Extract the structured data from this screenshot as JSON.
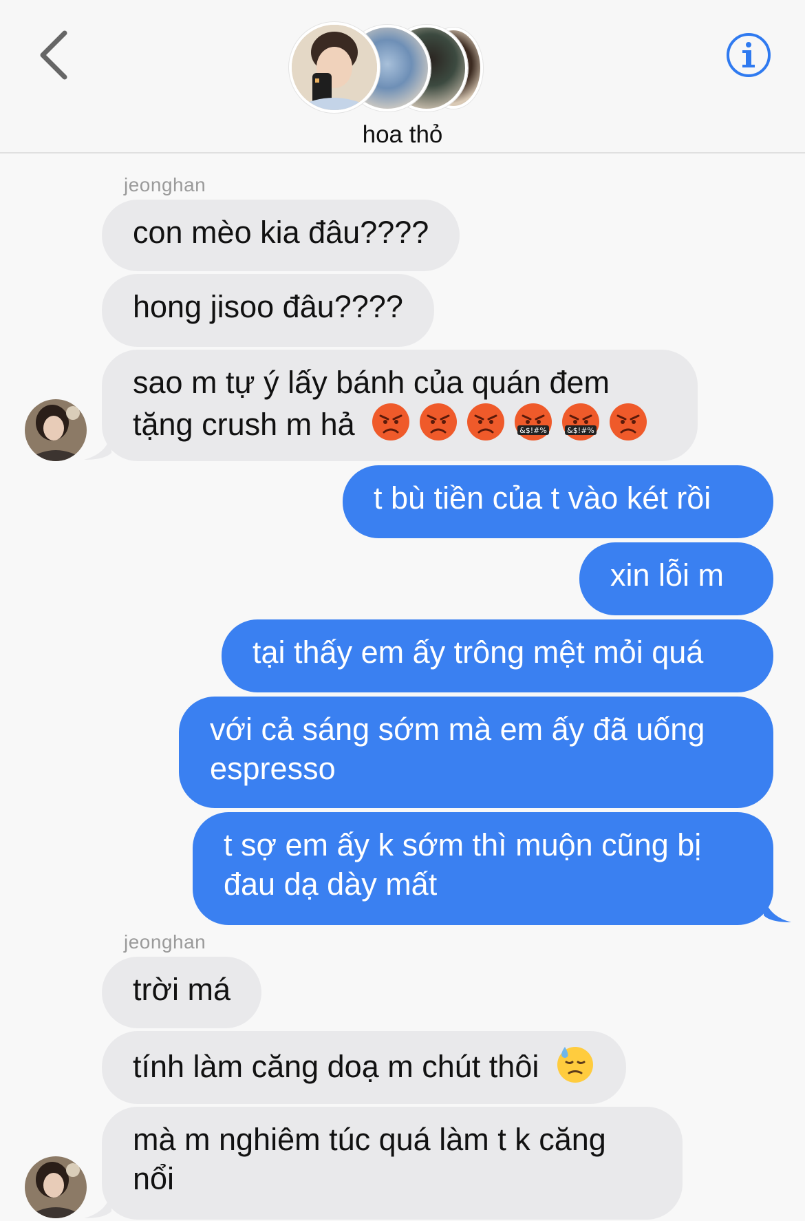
{
  "header": {
    "group_name": "hoa thỏ",
    "back_icon": "chevron-left-icon",
    "info_icon": "info-circle-icon"
  },
  "colors": {
    "outgoing_bubble": "#3a80f1",
    "incoming_bubble": "#e9e9eb",
    "accent": "#2f7af0",
    "background": "#f8f8f8"
  },
  "messages": {
    "sender_1": "jeonghan",
    "m1": "con mèo kia đâu????",
    "m2": "hong jisoo đâu????",
    "m3_line1": "sao m tự ý lấy bánh của quán đem",
    "m3_line2": "tặng crush m hả",
    "m3_emojis": [
      "pouting-face",
      "pouting-face",
      "pouting-face",
      "face-with-symbols-on-mouth",
      "face-with-symbols-on-mouth",
      "pouting-face"
    ],
    "m4": "t bù tiền của t vào két rồi",
    "m5": "xin lỗi m",
    "m6": "tại thấy em ấy trông mệt mỏi quá",
    "m7_line1": "với cả sáng sớm mà em ấy đã uống",
    "m7_line2": "espresso",
    "m8_line1": "t sợ em ấy k sớm thì muộn cũng bị",
    "m8_line2": "đau dạ dày mất",
    "sender_2": "jeonghan",
    "m9": "trời má",
    "m10": "tính làm căng doạ m chút thôi",
    "m10_emoji": "downcast-face-with-sweat",
    "m11_line1": "mà m nghiêm túc quá làm t k căng",
    "m11_line2": "nổi"
  }
}
